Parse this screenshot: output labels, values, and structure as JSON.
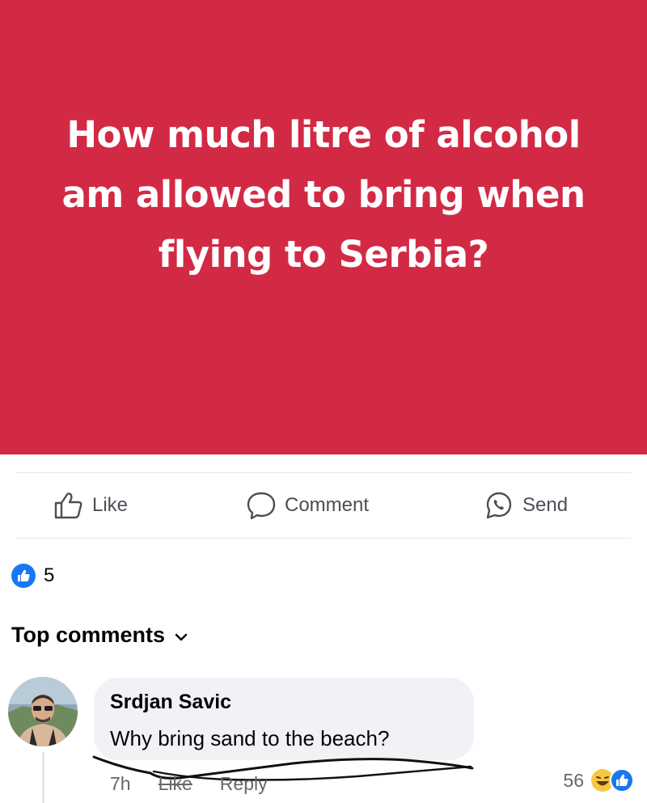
{
  "post": {
    "text": "How much litre of alcohol am allowed to bring when flying to Serbia?",
    "background_color": "#d22a45"
  },
  "actions": {
    "like_label": "Like",
    "comment_label": "Comment",
    "send_label": "Send"
  },
  "reactions": {
    "count": "5",
    "icon": "thumbs-up-icon"
  },
  "comments_section": {
    "heading": "Top comments"
  },
  "comment": {
    "author": "Srdjan Savic",
    "text": "Why bring sand to the beach?",
    "time": "7h",
    "like_label": "Like",
    "reply_label": "Reply",
    "reaction_count": "56",
    "reaction_icons": [
      "laugh-emoji-icon",
      "thumbs-up-icon"
    ]
  }
}
